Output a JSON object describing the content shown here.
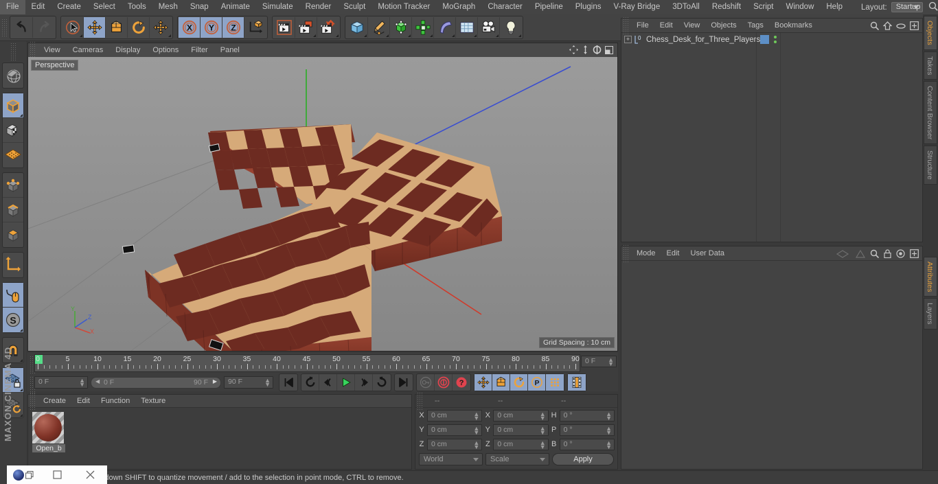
{
  "app": {
    "brand": "MAXON CINEMA 4D"
  },
  "menubar": {
    "items": [
      "File",
      "Edit",
      "Create",
      "Select",
      "Tools",
      "Mesh",
      "Snap",
      "Animate",
      "Simulate",
      "Render",
      "Sculpt",
      "Motion Tracker",
      "MoGraph",
      "Character",
      "Pipeline",
      "Plugins",
      "V-Ray Bridge",
      "3DToAll",
      "Redshift",
      "Script",
      "Window",
      "Help"
    ],
    "layout_label": "Layout:",
    "layout_value": "Startup",
    "search_icon": "search-icon"
  },
  "toolbar": {
    "groups": [
      {
        "name": "undo-redo",
        "buttons": [
          {
            "name": "undo-button",
            "icon": "undo-arrow-icon",
            "active": false,
            "has_corner": false
          },
          {
            "name": "redo-button",
            "icon": "redo-arrow-icon",
            "active": false,
            "has_corner": false
          }
        ]
      },
      {
        "name": "transform-tools",
        "buttons": [
          {
            "name": "select-tool",
            "icon": "cursor-select-icon",
            "active": false,
            "has_corner": true
          },
          {
            "name": "move-tool",
            "icon": "move-arrows-icon",
            "active": true,
            "has_corner": false
          },
          {
            "name": "scale-tool",
            "icon": "scale-box-icon",
            "active": false,
            "has_corner": false
          },
          {
            "name": "rotate-tool",
            "icon": "rotate-circle-icon",
            "active": false,
            "has_corner": false
          },
          {
            "name": "dynamic-place-tool",
            "icon": "move-arrows-icon",
            "active": false,
            "has_corner": true
          }
        ]
      },
      {
        "name": "axis-locks",
        "buttons": [
          {
            "name": "lock-x-axis",
            "icon": "x-axis-icon",
            "active": true,
            "has_corner": false
          },
          {
            "name": "lock-y-axis",
            "icon": "y-axis-icon",
            "active": true,
            "has_corner": false
          },
          {
            "name": "lock-z-axis",
            "icon": "z-axis-icon",
            "active": true,
            "has_corner": false
          },
          {
            "name": "world-object-coords",
            "icon": "world-axis-cube-icon",
            "active": false,
            "has_corner": false
          }
        ]
      },
      {
        "name": "render-tools",
        "buttons": [
          {
            "name": "render-view-button",
            "icon": "render-clapper-icon",
            "active": false,
            "has_corner": false
          },
          {
            "name": "render-picture-viewer-button",
            "icon": "render-picture-icon",
            "active": false,
            "has_corner": true
          },
          {
            "name": "render-settings-button",
            "icon": "render-settings-icon",
            "active": false,
            "has_corner": true
          }
        ]
      },
      {
        "name": "create-objects",
        "buttons": [
          {
            "name": "add-cube-button",
            "icon": "cube-icon",
            "active": false,
            "has_corner": true
          },
          {
            "name": "add-spline-button",
            "icon": "pen-spline-icon",
            "active": false,
            "has_corner": true
          },
          {
            "name": "add-nurbs-button",
            "icon": "green-cube-nurbs-icon",
            "active": false,
            "has_corner": true
          },
          {
            "name": "add-array-button",
            "icon": "green-array-icon",
            "active": false,
            "has_corner": true
          },
          {
            "name": "add-deformer-button",
            "icon": "bend-deformer-icon",
            "active": false,
            "has_corner": true
          },
          {
            "name": "add-environment-button",
            "icon": "floor-grid-icon",
            "active": false,
            "has_corner": true
          },
          {
            "name": "add-camera-button",
            "icon": "camera-icon",
            "active": false,
            "has_corner": true
          },
          {
            "name": "add-light-button",
            "icon": "light-bulb-icon",
            "active": false,
            "has_corner": true
          }
        ]
      }
    ]
  },
  "leftbar": {
    "groups": [
      {
        "name": "workplane-group",
        "buttons": [
          {
            "name": "make-editable-button",
            "icon": "globe-sphere-icon",
            "active": false,
            "has_corner": false
          }
        ]
      },
      {
        "name": "mode-group",
        "buttons": [
          {
            "name": "model-mode-button",
            "icon": "model-cube-icon",
            "active": true,
            "has_corner": true
          },
          {
            "name": "texture-mode-button",
            "icon": "texture-cube-icon",
            "active": false,
            "has_corner": false
          },
          {
            "name": "workplane-mode-button",
            "icon": "workplane-grid-icon",
            "active": false,
            "has_corner": false
          }
        ]
      },
      {
        "name": "component-group",
        "buttons": [
          {
            "name": "points-mode-button",
            "icon": "points-cube-icon",
            "active": false,
            "has_corner": false
          },
          {
            "name": "edges-mode-button",
            "icon": "edges-cube-icon",
            "active": false,
            "has_corner": false
          },
          {
            "name": "polygons-mode-button",
            "icon": "polygons-cube-icon",
            "active": false,
            "has_corner": false
          }
        ]
      },
      {
        "name": "axis-group",
        "buttons": [
          {
            "name": "enable-axis-modification-button",
            "icon": "axis-corner-icon",
            "active": false,
            "has_corner": false
          }
        ]
      },
      {
        "name": "snap-group",
        "buttons": [
          {
            "name": "viewport-solo-button",
            "icon": "mouse-orange-icon",
            "active": true,
            "has_corner": false
          },
          {
            "name": "enable-snap-button",
            "icon": "snap-s-icon",
            "active": true,
            "has_corner": true
          }
        ]
      },
      {
        "name": "magnet-group",
        "buttons": [
          {
            "name": "magnet-tool-button",
            "icon": "magnet-icon",
            "active": false,
            "has_corner": true
          }
        ]
      },
      {
        "name": "workplane-lock-group",
        "buttons": [
          {
            "name": "lock-workplane-button",
            "icon": "grid-lock-icon",
            "active": true,
            "has_corner": true
          },
          {
            "name": "planar-workplane-button",
            "icon": "grid-rotate-icon",
            "active": false,
            "has_corner": true
          }
        ]
      }
    ]
  },
  "viewport": {
    "menu": [
      "View",
      "Cameras",
      "Display",
      "Options",
      "Filter",
      "Panel"
    ],
    "corner_icons": [
      "pan-icon",
      "dolly-icon",
      "rotate-icon",
      "maximize-icon"
    ],
    "label": "Perspective",
    "grid_spacing": "Grid Spacing : 10 cm",
    "axis_labels": {
      "y": "Y",
      "z": "Z",
      "x": "X"
    },
    "axis_colors": {
      "x": "#d04a3a",
      "y": "#4aa83a",
      "z": "#3a5ad0"
    },
    "model": {
      "name": "Chess_Desk_for_Three_Players",
      "dark_square": "#6d2b21",
      "light_square": "#d6aa79",
      "side_color": "#8c3a2a"
    }
  },
  "timeline": {
    "ticks": [
      0,
      5,
      10,
      15,
      20,
      25,
      30,
      35,
      40,
      45,
      50,
      55,
      60,
      65,
      70,
      75,
      80,
      85,
      90
    ],
    "range_start": 0,
    "range_end": 90,
    "current_frame_field": "0 F",
    "preview_min": "0 F",
    "preview_max": "90 F",
    "end_frame_field": "90 F",
    "right_frame_field": "0 F",
    "transport": [
      {
        "name": "go-to-start-button",
        "icon": "skip-back-icon",
        "active": false
      },
      {
        "name": "play-backwards-loop-button",
        "icon": "loop-back-icon",
        "active": false
      },
      {
        "name": "previous-frame-button",
        "icon": "step-back-icon",
        "active": false
      },
      {
        "name": "play-button",
        "icon": "play-triangle-icon",
        "active": false
      },
      {
        "name": "next-frame-button",
        "icon": "step-forward-icon",
        "active": false
      },
      {
        "name": "play-forwards-loop-button",
        "icon": "loop-forward-icon",
        "active": false
      },
      {
        "name": "go-to-end-button",
        "icon": "skip-forward-icon",
        "active": false
      }
    ],
    "keys": [
      {
        "name": "record-active-objects-button",
        "icon": "key-gray-icon",
        "active": false
      },
      {
        "name": "autokeying-button",
        "icon": "autokey-red-icon",
        "active": false
      },
      {
        "name": "keyframe-selection-button",
        "icon": "question-red-icon",
        "active": false
      }
    ],
    "key_toggles": [
      {
        "name": "position-key-button",
        "icon": "move-arrows-icon",
        "active": true
      },
      {
        "name": "scale-key-button",
        "icon": "scale-box-icon",
        "active": true
      },
      {
        "name": "rotation-key-button",
        "icon": "rotate-circle-icon",
        "active": true
      },
      {
        "name": "parameter-key-button",
        "icon": "parameter-p-icon",
        "active": true
      },
      {
        "name": "point-level-animation-button",
        "icon": "dots-grid-icon",
        "active": true
      },
      {
        "name": "timeline-view-button",
        "icon": "filmstrip-icon",
        "active": true
      }
    ]
  },
  "material_manager": {
    "menu": [
      "Create",
      "Edit",
      "Function",
      "Texture"
    ],
    "materials": [
      {
        "name": "Open_b",
        "color": "#803327"
      }
    ]
  },
  "coordinate_manager": {
    "headers": [
      "--",
      "--",
      "--"
    ],
    "rows": [
      {
        "label1": "X",
        "value1": "0 cm",
        "label2": "X",
        "value2": "0 cm",
        "label3": "H",
        "value3": "0 °"
      },
      {
        "label1": "Y",
        "value1": "0 cm",
        "label2": "Y",
        "value2": "0 cm",
        "label3": "P",
        "value3": "0 °"
      },
      {
        "label1": "Z",
        "value1": "0 cm",
        "label2": "Z",
        "value2": "0 cm",
        "label3": "B",
        "value3": "0 °"
      }
    ],
    "coord_system": "World",
    "transform_mode": "Scale",
    "apply_label": "Apply"
  },
  "object_manager": {
    "menu": [
      "File",
      "Edit",
      "View",
      "Objects",
      "Tags",
      "Bookmarks"
    ],
    "header_icons": [
      "search-icon",
      "home-icon",
      "ellipse-icon",
      "add-panel-icon"
    ],
    "objects": [
      {
        "name": "Chess_Desk_for_Three_Players",
        "layer_badge": "0",
        "tag_color": "#5d8fc6",
        "dots": "green"
      }
    ]
  },
  "attribute_manager": {
    "menu": [
      "Mode",
      "Edit",
      "User Data"
    ],
    "header_icons": [
      "back-nav-icon",
      "forward-nav-icon",
      "search-icon",
      "lock-icon",
      "target-icon",
      "add-panel-icon"
    ]
  },
  "right_tabs": [
    {
      "label": "Objects",
      "active": true
    },
    {
      "label": "Takes",
      "active": false
    },
    {
      "label": "Content Browser",
      "active": false
    },
    {
      "label": "Structure",
      "active": false
    },
    {
      "label": "Attributes",
      "active": true
    },
    {
      "label": "Layers",
      "active": false
    }
  ],
  "status_bar": {
    "text": "Move elements. Hold down SHIFT to quantize movement / add to the selection in point mode, CTRL to remove."
  },
  "taskbar": {
    "app_icon": "cinema4d-logo-icon",
    "restore_icon": "restore-window-icon",
    "maximize_icon": "maximize-window-icon",
    "close_icon": "close-window-icon"
  }
}
